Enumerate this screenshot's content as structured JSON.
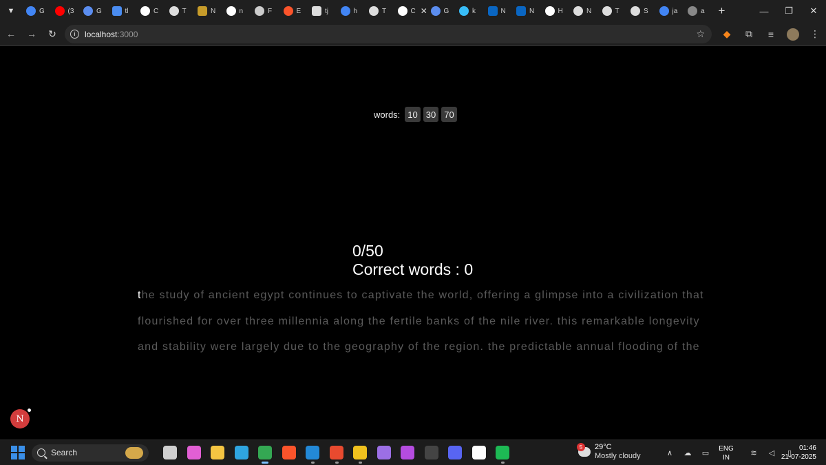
{
  "browser": {
    "tabs": [
      {
        "icon": "google-icon",
        "label": "G",
        "color": "#4285f4"
      },
      {
        "icon": "youtube-icon",
        "label": "(3",
        "color": "#ff0000"
      },
      {
        "icon": "gemini-icon",
        "label": "G",
        "color": "#5b8def"
      },
      {
        "icon": "app-icon",
        "label": "tl",
        "color": "#4a8cf0"
      },
      {
        "icon": "triangle-icon",
        "label": "C",
        "color": "#ffffff"
      },
      {
        "icon": "openai-icon",
        "label": "T",
        "color": "#dddddd"
      },
      {
        "icon": "mt-icon",
        "label": "N",
        "color": "#c79c2a"
      },
      {
        "icon": "github-icon",
        "label": "n",
        "color": "#ffffff"
      },
      {
        "icon": "globe-icon",
        "label": "F",
        "color": "#cccccc"
      },
      {
        "icon": "brave-icon",
        "label": "E",
        "color": "#fb542b"
      },
      {
        "icon": "box-icon",
        "label": "tj",
        "color": "#dddddd"
      },
      {
        "icon": "google-icon",
        "label": "h",
        "color": "#4285f4"
      },
      {
        "icon": "openai-icon",
        "label": "T",
        "color": "#dddddd"
      },
      {
        "icon": "close-icon",
        "label": "C",
        "color": "#ffffff",
        "active": true
      },
      {
        "icon": "gemini-icon",
        "label": "G",
        "color": "#5b8def"
      },
      {
        "icon": "wave-icon",
        "label": "k",
        "color": "#38bdf8"
      },
      {
        "icon": "linkedin-icon",
        "label": "N",
        "color": "#0a66c2"
      },
      {
        "icon": "linkedin-icon",
        "label": "N",
        "color": "#0a66c2"
      },
      {
        "icon": "x-icon",
        "label": "H",
        "color": "#ffffff"
      },
      {
        "icon": "chrome-icon",
        "label": "N",
        "color": "#dddddd"
      },
      {
        "icon": "openai-icon",
        "label": "T",
        "color": "#dddddd"
      },
      {
        "icon": "openai-icon",
        "label": "S",
        "color": "#dddddd"
      },
      {
        "icon": "google-icon",
        "label": "ja",
        "color": "#4285f4"
      },
      {
        "icon": "github-icon",
        "label": "a",
        "color": "#888888"
      }
    ],
    "url_host": "localhost",
    "url_port": ":3000"
  },
  "app": {
    "words_label": "words:",
    "word_options": [
      "10",
      "30",
      "70"
    ],
    "counter": "0/50",
    "correct_words": "Correct words : 0",
    "typed_text": "t",
    "remaining_text": "he study of ancient egypt continues to captivate the world, offering a glimpse into a civilization that flourished for over three millennia along the fertile banks of the nile river. this remarkable longevity and stability were largely due to the geography of the region. the predictable annual flooding of the",
    "badge_letter": "N"
  },
  "taskbar": {
    "search_label": "Search",
    "apps": [
      {
        "icon": "task-view-icon",
        "color": "#cfcfcf"
      },
      {
        "icon": "copilot-icon",
        "color": "#e25fd4"
      },
      {
        "icon": "file-explorer-icon",
        "color": "#f4c542"
      },
      {
        "icon": "edge-icon",
        "color": "#2fa5e0"
      },
      {
        "icon": "chrome-icon",
        "color": "#34a853",
        "state": "active"
      },
      {
        "icon": "brave-icon",
        "color": "#fb542b"
      },
      {
        "icon": "vscode-icon",
        "color": "#2389d7",
        "state": "open"
      },
      {
        "icon": "postman-icon",
        "color": "#e84a2f",
        "state": "open"
      },
      {
        "icon": "git-icon",
        "color": "#f0c11e",
        "state": "open"
      },
      {
        "icon": "leaf-icon",
        "color": "#9c6fe5"
      },
      {
        "icon": "intellij-icon",
        "color": "#b54ce0"
      },
      {
        "icon": "terminal-icon",
        "color": "#444444"
      },
      {
        "icon": "discord-icon",
        "color": "#5865f2"
      },
      {
        "icon": "notion-icon",
        "color": "#ffffff"
      },
      {
        "icon": "spotify-icon",
        "color": "#1db954",
        "state": "open"
      }
    ],
    "weather_badge": "5",
    "weather_temp": "29°C",
    "weather_desc": "Mostly cloudy",
    "lang_1": "ENG",
    "lang_2": "IN",
    "time": "01:46",
    "date": "21-07-2025"
  }
}
